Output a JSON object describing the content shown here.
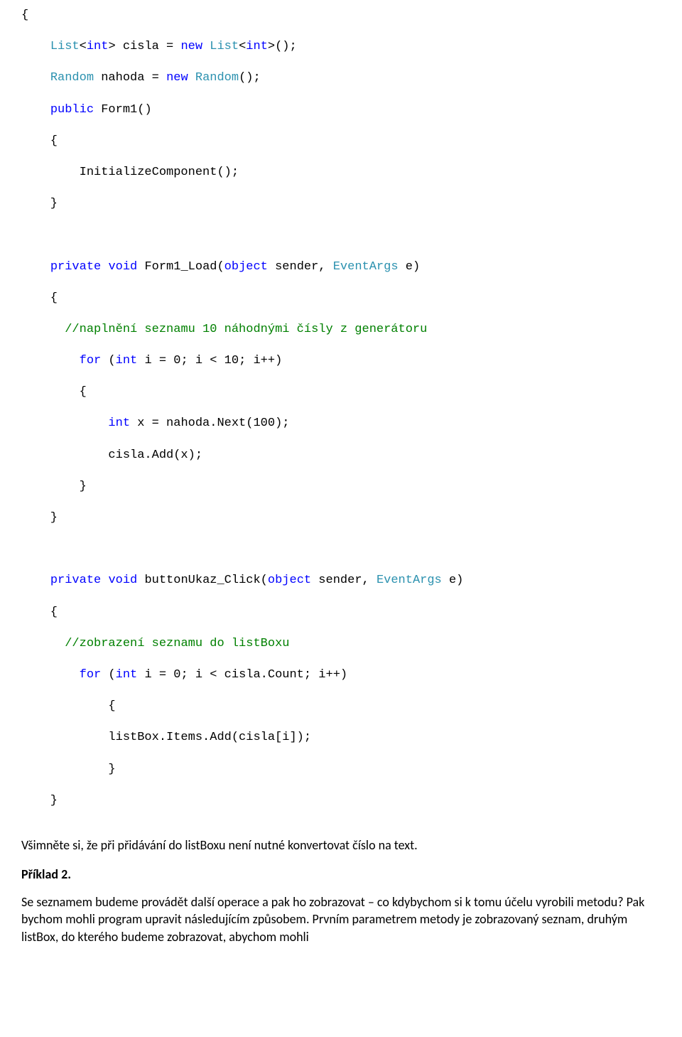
{
  "code": {
    "t01": "{",
    "t02a": "    ",
    "t02b": "List",
    "t02c": "<",
    "t02d": "int",
    "t02e": "> cisla = ",
    "t02f": "new",
    "t02g": " ",
    "t02h": "List",
    "t02i": "<",
    "t02j": "int",
    "t02k": ">();",
    "t03a": "    ",
    "t03b": "Random",
    "t03c": " nahoda = ",
    "t03d": "new",
    "t03e": " ",
    "t03f": "Random",
    "t03g": "();",
    "t04a": "    ",
    "t04b": "public",
    "t04c": " Form1()",
    "t05": "    {",
    "t06": "        InitializeComponent();",
    "t07": "    }",
    "blank1": "",
    "t08a": "    ",
    "t08b": "private",
    "t08c": " ",
    "t08d": "void",
    "t08e": " Form1_Load(",
    "t08f": "object",
    "t08g": " sender, ",
    "t08h": "EventArgs",
    "t08i": " e)",
    "t09": "    {",
    "t10a": "      ",
    "t10b": "//naplnění seznamu 10 náhodnými čísly z generátoru",
    "t11a": "        ",
    "t11b": "for",
    "t11c": " (",
    "t11d": "int",
    "t11e": " i = 0; i < 10; i++)",
    "t12": "        {",
    "t13a": "            ",
    "t13b": "int",
    "t13c": " x = nahoda.Next(100);",
    "t14": "            cisla.Add(x);",
    "t15": "        }",
    "t16": "    }",
    "blank2": "",
    "t17a": "    ",
    "t17b": "private",
    "t17c": " ",
    "t17d": "void",
    "t17e": " buttonUkaz_Click(",
    "t17f": "object",
    "t17g": " sender, ",
    "t17h": "EventArgs",
    "t17i": " e)",
    "t18": "    {",
    "t19a": "      ",
    "t19b": "//zobrazení seznamu do listBoxu",
    "t20a": "        ",
    "t20b": "for",
    "t20c": " (",
    "t20d": "int",
    "t20e": " i = 0; i < cisla.Count; i++)",
    "t21": "            {",
    "t22": "            listBox.Items.Add(cisla[i]);",
    "t23": "            }",
    "t24": "    }"
  },
  "para1": "Všimněte si, že při přidávání do listBoxu není nutné konvertovat číslo na text.",
  "heading": "Příklad 2.",
  "para2": "Se seznamem budeme provádět další operace a pak ho zobrazovat – co kdybychom si k tomu účelu vyrobili metodu? Pak bychom mohli program upravit následujícím způsobem. Prvním parametrem metody je zobrazovaný seznam, druhým listBox, do kterého budeme zobrazovat, abychom mohli"
}
